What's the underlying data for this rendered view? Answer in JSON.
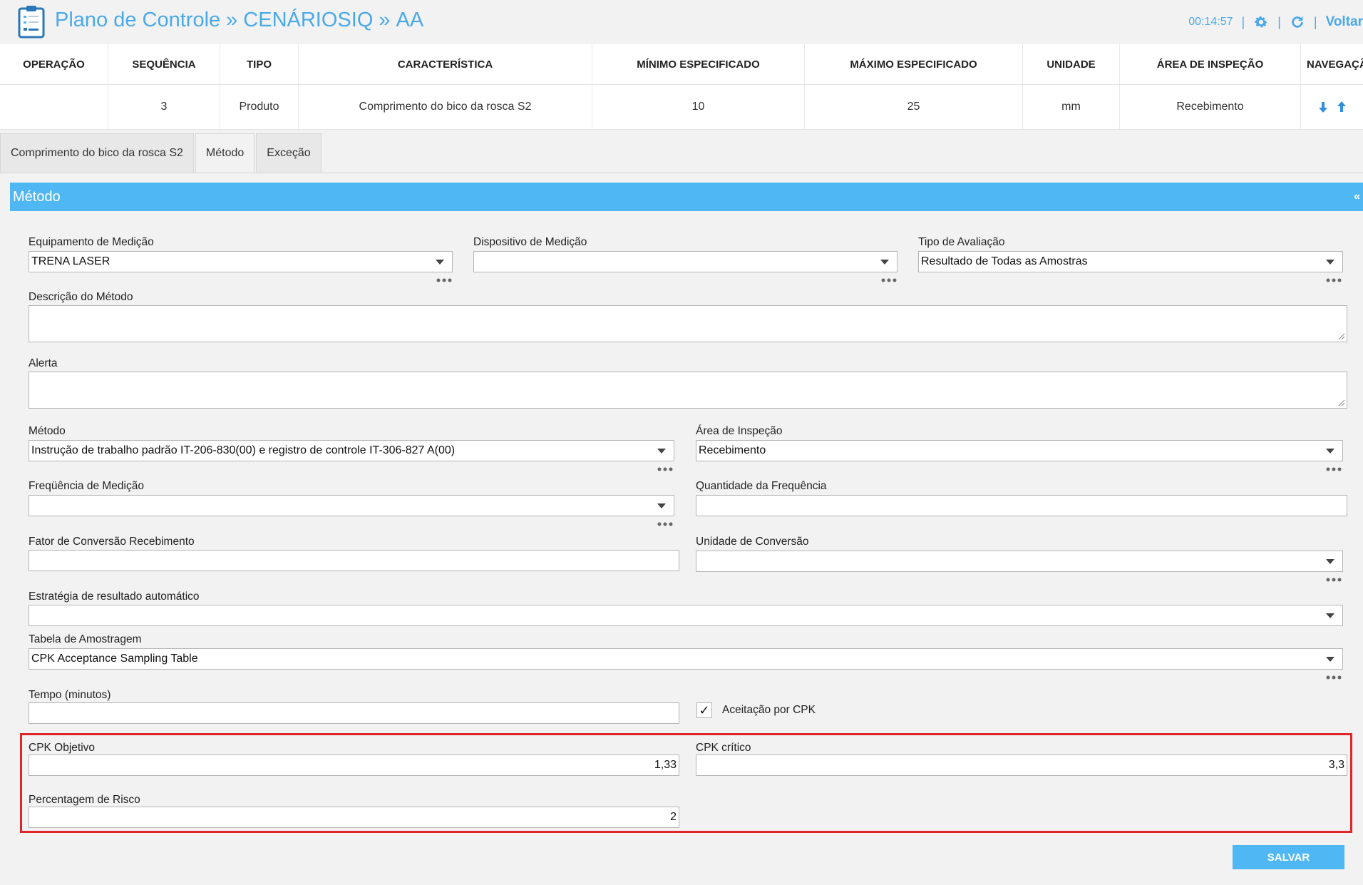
{
  "header": {
    "title_parts": [
      "Plano de Controle",
      "»",
      "CENÁRIOSIQ",
      "»",
      "AA"
    ],
    "timer": "00:14:57",
    "pipe": "|",
    "back_label": "Voltar"
  },
  "grid": {
    "columns": [
      "OPERAÇÃO",
      "SEQUÊNCIA",
      "TIPO",
      "CARACTERÍSTICA",
      "MÍNIMO ESPECIFICADO",
      "MÁXIMO ESPECIFICADO",
      "UNIDADE",
      "ÁREA DE INSPEÇÃO",
      "NAVEGAÇÃO"
    ],
    "row": {
      "operacao": "",
      "sequencia": "3",
      "tipo": "Produto",
      "caracteristica": "Comprimento do bico da rosca S2",
      "minimo": "10",
      "maximo": "25",
      "unidade": "mm",
      "area": "Recebimento"
    }
  },
  "tabs": [
    {
      "label": "Comprimento do bico da rosca S2"
    },
    {
      "label": "Método"
    },
    {
      "label": "Exceção"
    }
  ],
  "panel": {
    "title": "Método",
    "collapse": "«"
  },
  "form": {
    "equipamento": {
      "label": "Equipamento de Medição",
      "value": "TRENA LASER"
    },
    "dispositivo": {
      "label": "Dispositivo de Medição",
      "value": ""
    },
    "tipo_avaliacao": {
      "label": "Tipo de Avaliação",
      "value": "Resultado de Todas as Amostras"
    },
    "descricao": {
      "label": "Descrição do Método",
      "value": ""
    },
    "alerta": {
      "label": "Alerta",
      "value": ""
    },
    "metodo": {
      "label": "Método",
      "value": "Instrução de trabalho padrão IT-206-830(00) e registro de controle IT-306-827 A(00)"
    },
    "area_inspecao": {
      "label": "Área de Inspeção",
      "value": "Recebimento"
    },
    "frequencia": {
      "label": "Freqüência de Medição",
      "value": ""
    },
    "quantidade_frequencia": {
      "label": "Quantidade da Frequência",
      "value": ""
    },
    "fator_conversao": {
      "label": "Fator de Conversão Recebimento",
      "value": ""
    },
    "unidade_conversao": {
      "label": "Unidade de Conversão",
      "value": ""
    },
    "estrategia": {
      "label": "Estratégia de resultado automático",
      "value": ""
    },
    "tabela_amostragem": {
      "label": "Tabela de Amostragem",
      "value": "CPK Acceptance Sampling Table"
    },
    "tempo": {
      "label": "Tempo (minutos)",
      "value": ""
    },
    "aceitacao_cpk": {
      "label": "Aceitação por CPK",
      "checked": true,
      "mark": "✓"
    },
    "cpk_objetivo": {
      "label": "CPK Objetivo",
      "value": "1,33"
    },
    "cpk_critico": {
      "label": "CPK crítico",
      "value": "3,3"
    },
    "percentagem_risco": {
      "label": "Percentagem de Risco",
      "value": "2"
    }
  },
  "actions": {
    "save_label": "SALVAR"
  },
  "colors": {
    "accent": "#4fb7f4",
    "title": "#4aa9ea",
    "highlight": "#e0262a"
  }
}
